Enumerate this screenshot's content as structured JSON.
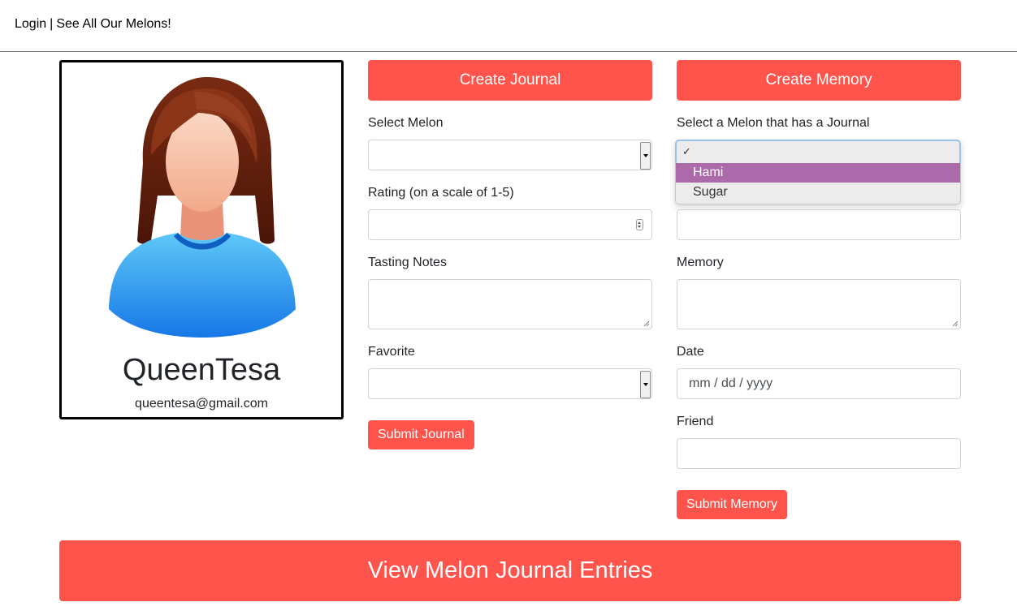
{
  "nav": {
    "login": "Login",
    "separator": "|",
    "see_all": "See All Our Melons!"
  },
  "profile": {
    "username": "QueenTesa",
    "email": "queentesa@gmail.com",
    "avatar_icon": "woman-avatar-icon"
  },
  "journal_form": {
    "header_button": "Create Journal",
    "select_melon_label": "Select Melon",
    "select_melon_value": "",
    "rating_label": "Rating (on a scale of 1-5)",
    "rating_value": "",
    "tasting_notes_label": "Tasting Notes",
    "favorite_label": "Favorite",
    "favorite_value": "",
    "submit_button": "Submit Journal"
  },
  "memory_form": {
    "header_button": "Create Memory",
    "select_melon_label": "Select a Melon that has a Journal",
    "dropdown": {
      "checkmark": "✓",
      "options": [
        "Hami",
        "Sugar"
      ],
      "highlighted": "Hami"
    },
    "memory_label": "Memory",
    "date_label": "Date",
    "date_placeholder": "mm / dd / yyyy",
    "friend_label": "Friend",
    "submit_button": "Submit Memory"
  },
  "footer_button": "View Melon Journal Entries",
  "colors": {
    "accent": "#ff544b",
    "dropdown_highlight": "#ad6aaa"
  }
}
